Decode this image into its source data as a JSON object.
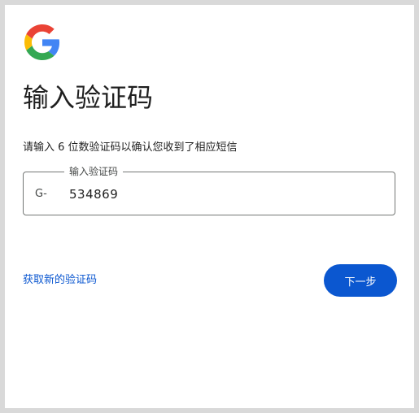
{
  "logo": {
    "icon": "google-g-logo-icon"
  },
  "heading": {
    "title": "输入验证码"
  },
  "instructions": {
    "text": "请输入 6 位数验证码以确认您收到了相应短信"
  },
  "code_field": {
    "label": "输入验证码",
    "prefix": "G-",
    "value": "534869"
  },
  "actions": {
    "resend_label": "获取新的验证码",
    "next_label": "下一步"
  },
  "colors": {
    "accent": "#0b57d0",
    "google_blue": "#4285F4",
    "google_red": "#EA4335",
    "google_yellow": "#FBBC05",
    "google_green": "#34A853"
  }
}
